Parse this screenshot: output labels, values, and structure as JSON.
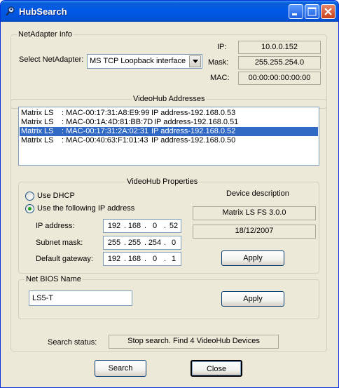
{
  "window": {
    "title": "HubSearch",
    "accent": "#0058E6"
  },
  "netadapter": {
    "legend": "NetAdapter Info",
    "select_label": "Select NetAdapter:",
    "selected": "MS TCP Loopback interface",
    "ip_label": "IP:",
    "ip": "10.0.0.152",
    "mask_label": "Mask:",
    "mask": "255.255.254.0",
    "mac_label": "MAC:",
    "mac": "00:00:00:00:00:00"
  },
  "hubs": {
    "legend": "VideoHub Addresses",
    "items": [
      {
        "name": "Matrix LS",
        "mac": ": MAC-00:17:31:A8:E9:99",
        "ip": "IP address-192.168.0.53",
        "selected": false
      },
      {
        "name": "Matrix LS",
        "mac": ": MAC-00:1A:4D:81:BB:7D",
        "ip": "IP address-192.168.0.51",
        "selected": false
      },
      {
        "name": "Matrix LS",
        "mac": ": MAC-00:17:31:2A:02:31",
        "ip": "IP address-192.168.0.52",
        "selected": true
      },
      {
        "name": "Matrix LS",
        "mac": ": MAC-00:40:63:F1:01:43",
        "ip": "IP address-192.168.0.50",
        "selected": false
      }
    ]
  },
  "props": {
    "legend": "VideoHub Properties",
    "use_dhcp": "Use DHCP",
    "use_static": "Use the following IP address",
    "ip_label": "IP address:",
    "ip": [
      "192",
      "168",
      "0",
      "52"
    ],
    "subnet_label": "Subnet mask:",
    "subnet": [
      "255",
      "255",
      "254",
      "0"
    ],
    "gateway_label": "Default gateway:",
    "gateway": [
      "192",
      "168",
      "0",
      "1"
    ],
    "device_desc_label": "Device description",
    "device_desc": "Matrix LS FS 3.0.0",
    "date": "18/12/2007",
    "apply": "Apply"
  },
  "netbios": {
    "legend": "Net BIOS Name",
    "value": "LS5-T",
    "apply": "Apply"
  },
  "status": {
    "label": "Search status:",
    "text": "Stop search. Find 4 VideoHub Devices"
  },
  "buttons": {
    "search": "Search",
    "close": "Close"
  },
  "icons": {
    "app": "magnifier-person-icon",
    "minimize": "minimize-icon",
    "maximize": "maximize-icon",
    "close": "close-icon"
  }
}
